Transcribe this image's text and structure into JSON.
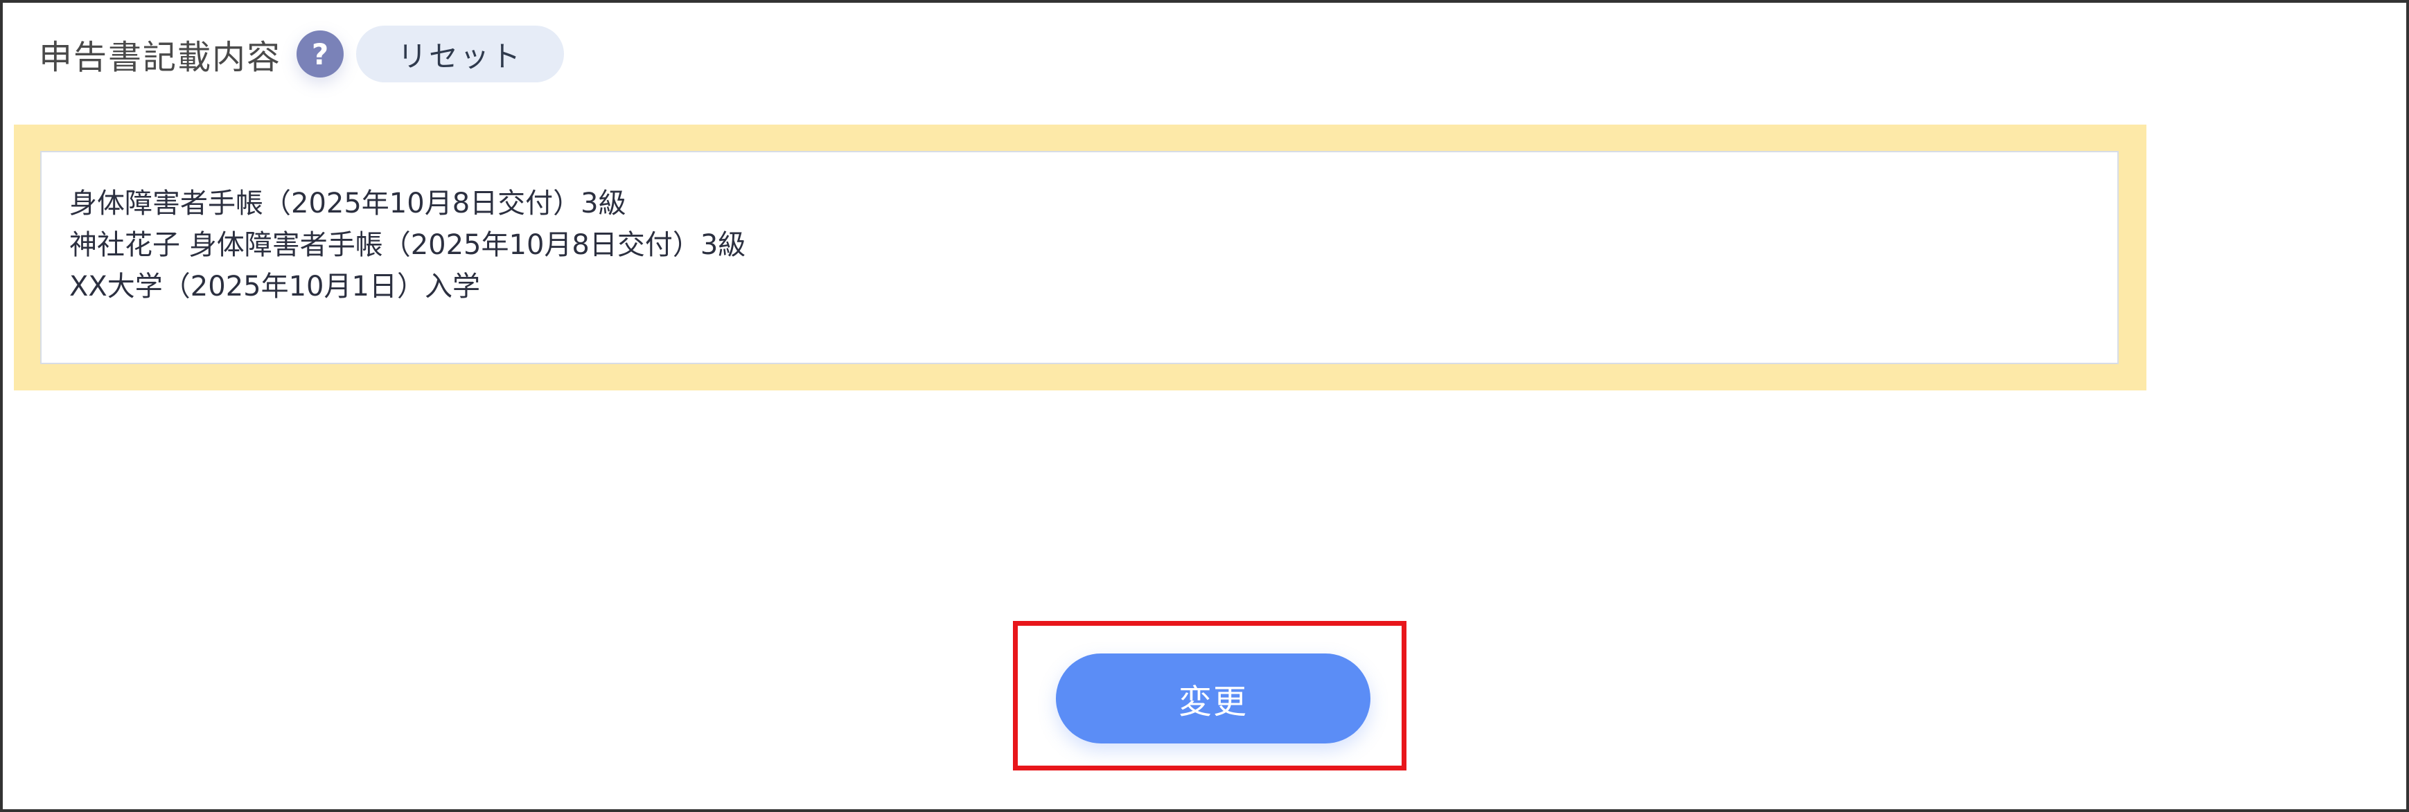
{
  "header": {
    "title": "申告書記載内容",
    "help_icon_glyph": "?",
    "reset_label": "リセット"
  },
  "note": {
    "lines": [
      "身体障害者手帳（2025年10月8日交付）3級",
      "神社花子 身体障害者手帳（2025年10月8日交付）3級",
      "XX大学（2025年10月1日）入学"
    ]
  },
  "actions": {
    "change_label": "変更"
  },
  "colors": {
    "panel_background": "#fde9a8",
    "help_icon": "#7a82b8",
    "reset_button": "#e6ecf7",
    "change_button": "#5b8df6",
    "highlight_frame": "#e8161b"
  }
}
